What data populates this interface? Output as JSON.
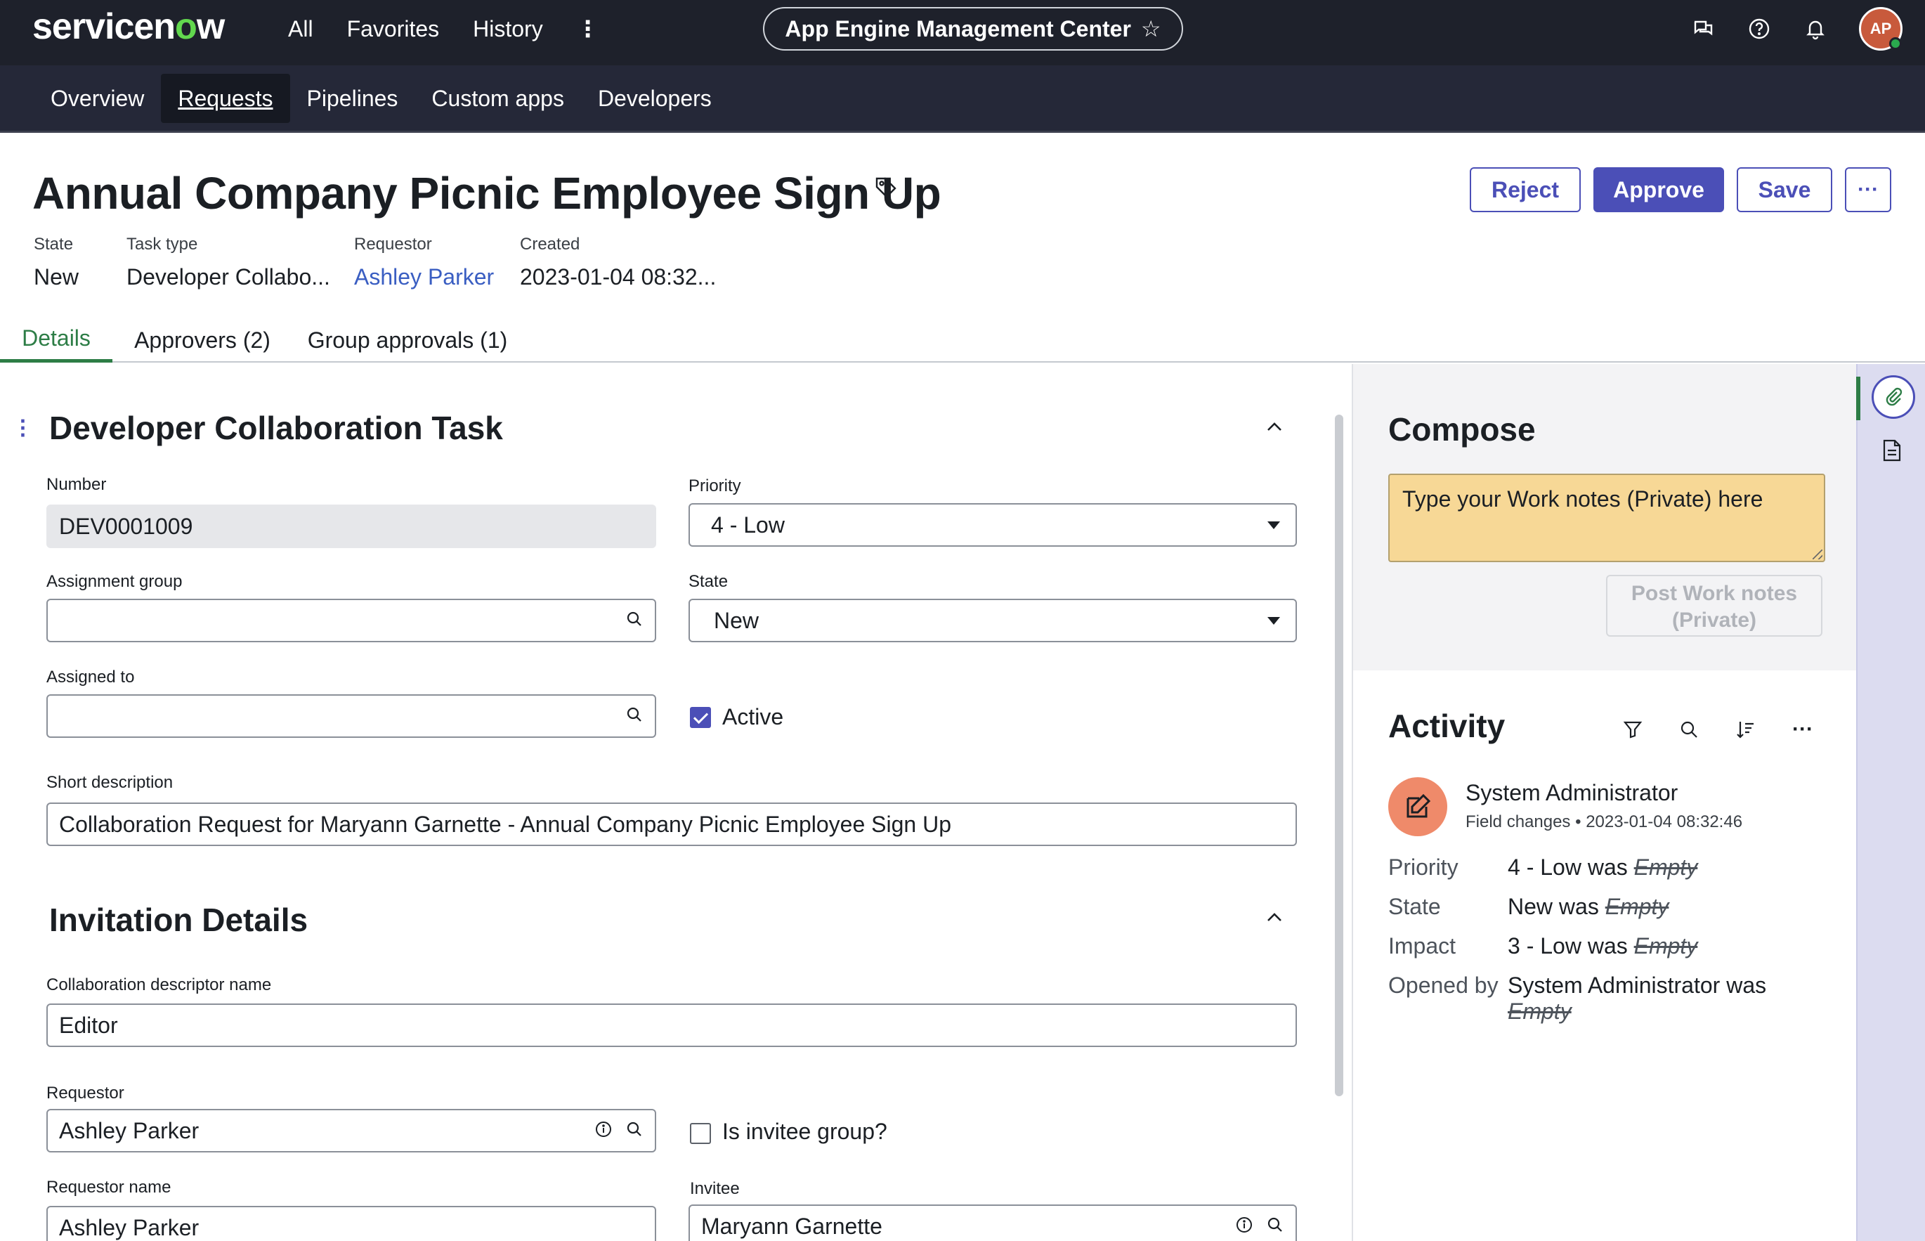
{
  "brand": {
    "logo_text_a": "servicen",
    "logo_text_o": "o",
    "logo_text_b": "w",
    "accent": "#4b4fb7",
    "green": "#62d84e"
  },
  "topnav": {
    "all": "All",
    "favorites": "Favorites",
    "history": "History",
    "more": "⋮"
  },
  "app_pill": {
    "title": "App Engine Management Center",
    "star": "☆"
  },
  "avatar_initials": "AP",
  "subnav": {
    "overview": "Overview",
    "requests": "Requests",
    "pipelines": "Pipelines",
    "custom_apps": "Custom apps",
    "developers": "Developers"
  },
  "record": {
    "title": "Annual Company Picnic Employee Sign Up",
    "buttons": {
      "reject": "Reject",
      "approve": "Approve",
      "save": "Save",
      "more": "···"
    },
    "meta": {
      "state_label": "State",
      "state_value": "New",
      "task_type_label": "Task type",
      "task_type_value": "Developer Collabo...",
      "requestor_label": "Requestor",
      "requestor_value": "Ashley Parker",
      "created_label": "Created",
      "created_value": "2023-01-04 08:32..."
    }
  },
  "tabs": {
    "details": "Details",
    "approvers": "Approvers (2)",
    "group_approvals": "Group approvals (1)"
  },
  "form": {
    "section1_title": "Developer Collaboration Task",
    "number_label": "Number",
    "number_value": "DEV0001009",
    "priority_label": "Priority",
    "priority_value": "4 - Low",
    "assignment_group_label": "Assignment group",
    "assignment_group_value": "",
    "state_label": "State",
    "state_value": "New",
    "assigned_to_label": "Assigned to",
    "assigned_to_value": "",
    "active_label": "Active",
    "short_description_label": "Short description",
    "short_description_value": "Collaboration Request for Maryann Garnette - Annual Company Picnic Employee Sign Up",
    "section2_title": "Invitation Details",
    "descriptor_label": "Collaboration descriptor name",
    "descriptor_value": "Editor",
    "requestor_label": "Requestor",
    "requestor_value": "Ashley Parker",
    "invitee_group_label": "Is invitee group?",
    "requestor_name_label": "Requestor name",
    "requestor_name_value": "Ashley Parker",
    "invitee_label": "Invitee",
    "invitee_value": "Maryann Garnette"
  },
  "compose": {
    "title": "Compose",
    "worknotes_placeholder": "Type your Work notes (Private) here",
    "post_line1": "Post Work notes",
    "post_line2": "(Private)"
  },
  "activity": {
    "title": "Activity",
    "more": "···",
    "user": "System Administrator",
    "sub_kind": "Field changes",
    "sub_time": "2023-01-04 08:32:46",
    "changes": [
      {
        "field": "Priority",
        "new": "4 - Low",
        "was": "was",
        "old": "Empty"
      },
      {
        "field": "State",
        "new": "New",
        "was": "was",
        "old": "Empty"
      },
      {
        "field": "Impact",
        "new": "3 - Low",
        "was": "was",
        "old": "Empty"
      },
      {
        "field": "Opened by",
        "new": "System Administrator",
        "was": "was",
        "old": "Empty"
      }
    ]
  }
}
